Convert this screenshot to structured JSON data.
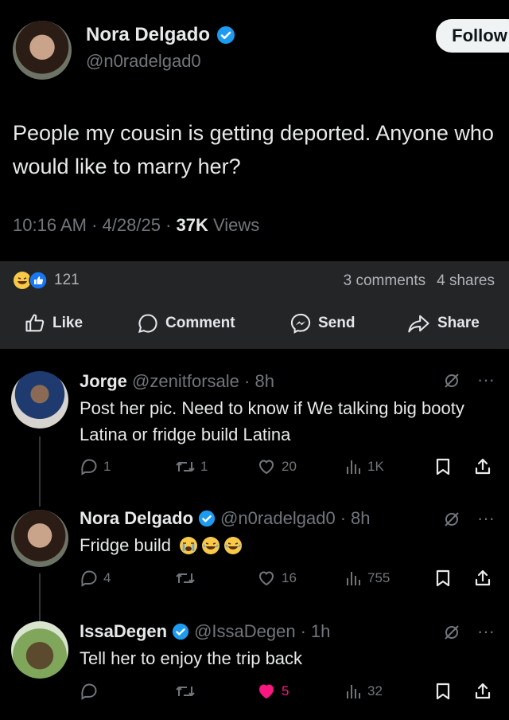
{
  "post": {
    "author_name": "Nora Delgado",
    "author_handle": "@n0radelgad0",
    "follow_label": "Follow",
    "text": "People my cousin is getting deported. Anyone who would like to marry her?",
    "time": "10:16 AM",
    "date": "4/28/25",
    "views_count": "37K",
    "views_label": "Views"
  },
  "facebook_bar": {
    "reaction_count": "121",
    "comments": "3 comments",
    "shares": "4 shares",
    "actions": {
      "like": "Like",
      "comment": "Comment",
      "send": "Send",
      "share": "Share"
    }
  },
  "replies": [
    {
      "name": "Jorge",
      "handle": "@zenitforsale",
      "time": "8h",
      "text": "Post her pic. Need to know if We talking big booty Latina or fridge build Latina",
      "replies": "1",
      "reposts": "1",
      "likes": "20",
      "views": "1K",
      "verified": false
    },
    {
      "name": "Nora Delgado",
      "handle": "@n0radelgad0",
      "time": "8h",
      "text": "Fridge build",
      "replies": "4",
      "reposts": "",
      "likes": "16",
      "views": "755",
      "verified": true
    },
    {
      "name": "IssaDegen",
      "handle": "@IssaDegen",
      "time": "1h",
      "text": "Tell her to enjoy the trip back",
      "replies": "",
      "reposts": "",
      "likes": "5",
      "views": "32",
      "verified": true
    }
  ],
  "colors": {
    "verified_blue": "#1d9bf0",
    "like_pink": "#f91880",
    "fb_bar": "#242526",
    "muted": "#71767b"
  },
  "icons": [
    "verified-icon",
    "grok-icon",
    "more-icon",
    "reply-icon",
    "repost-icon",
    "heart-icon",
    "views-icon",
    "bookmark-icon",
    "share-icon",
    "like-thumb-icon",
    "comment-bubble-icon",
    "messenger-icon",
    "fb-share-icon"
  ]
}
